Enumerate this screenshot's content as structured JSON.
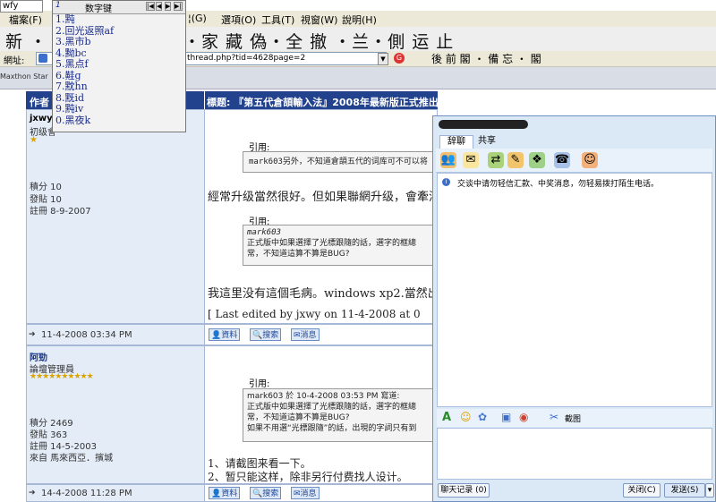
{
  "ime": {
    "input_text": "wfy",
    "title": "数字键",
    "page_label": "1",
    "nav_glyphs": [
      "|◀",
      "◀",
      "▶",
      "▶|"
    ],
    "candidates": [
      "1.黗",
      "2.回光返照af",
      "3.黑市b",
      "4.黝bc",
      "5.黑点f",
      "6.黊g",
      "7.黕hn",
      "8.黖id",
      "9.黗iv",
      "0.黑夜k"
    ]
  },
  "browser": {
    "menu": [
      "檔案(F)",
      "說明(H)",
      "選項(O)",
      "工具(T)",
      "視窗(W)",
      "說明(H)"
    ],
    "menu_partial": "¦(G)",
    "banner_left": "新 ・ 北",
    "banner_right": "・家 藏 偽・全 撤 ・兰・側 运 止",
    "banner_right2": "後 前 閣 ・ 備 忘 ・ 閣",
    "address_label": "網址:",
    "address_value": "thread.php?tid=4628page=2",
    "tab_label": "Maxthon Star"
  },
  "forum": {
    "header_author": "作者",
    "header_title": "標题: 『第五代倉頡輸入法』2008年最新版正式推出!",
    "post1": {
      "author": "jxwy",
      "rank": "初级會",
      "points": "積分 10",
      "posts": "發貼 10",
      "registered": "註冊 8-9-2007",
      "time": "11-4-2008 03:34 PM",
      "quote1_label": "引用:",
      "quote1_text": "mark603另外，不知道倉頡五代的词库可不可以将",
      "line1": "經常升级當然很好。但如果聯網升级，會牽涉",
      "quote2_label": "引用:",
      "quote2_author": "mark603",
      "quote2_line1": "正式版中如果選擇了光標跟隨的話，選字的框總",
      "quote2_line2": "常，不知道這算不算是BUG?",
      "line2": "我這里没有這個毛病。windows xp2.當然出現",
      "edited": "[ Last edited by jxwy on 11-4-2008 at 0"
    },
    "post2": {
      "author": "阿勁",
      "rank": "論壇管理員",
      "stars": "★★★★★★★★★★",
      "points": "積分 2469",
      "posts": "發貼 363",
      "registered": "註冊 14-5-2003",
      "from": "來自 馬來西亞．擯城",
      "time": "14-4-2008 11:28 PM",
      "quote_label": "引用:",
      "quote_head": "mark603 於 10-4-2008 03:53 PM 寫道:",
      "quote_line1": "正式版中如果選擇了光標跟隨的話，選字的框總",
      "quote_line2": "常，不知道這算不算是BUG?",
      "quote_line3": "如果不用選“光標跟隨”的話，出現的字詞只有到",
      "reply1": "1、请截图来看一下。",
      "reply2": "2、暂只能这样，除非另行付费找人设计。"
    },
    "buttons": [
      "資料",
      "搜索",
      "消息"
    ]
  },
  "chat": {
    "tabs": [
      "辞聊",
      "共享"
    ],
    "notice": "交谈中请勿轻信汇款、中奖消息，勿轻易拨打陌生电话。",
    "screenshot_label": "截图",
    "history_label": "聊天记录",
    "close_label": "关闭(C)",
    "send_label": "发送(S)"
  },
  "colors": {
    "forum_header": "#23428e",
    "chat_bg": "#dbe8f6"
  }
}
